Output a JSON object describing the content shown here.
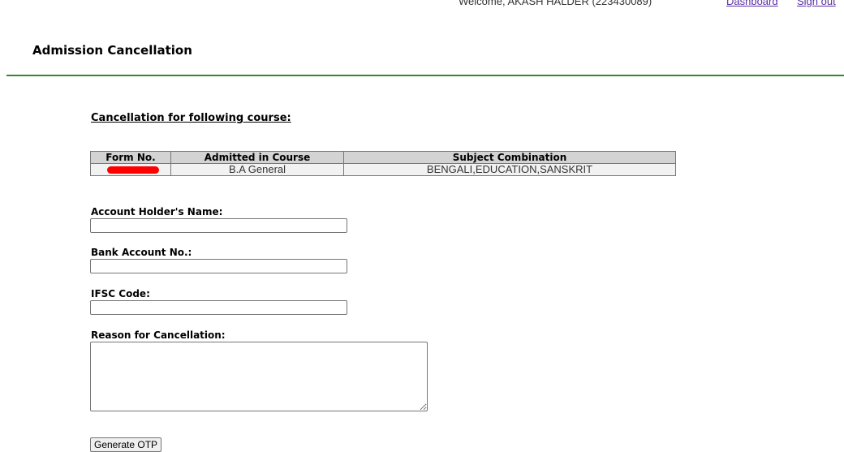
{
  "header": {
    "welcome_text": "Welcome, AKASH HALDER (223430089)",
    "dashboard_link": "Dashboard",
    "signout_link": "Sign out"
  },
  "page": {
    "title": "Admission Cancellation"
  },
  "cancellation": {
    "heading": "Cancellation for following course:",
    "table": {
      "headers": [
        "Form No.",
        "Admitted in Course",
        "Subject Combination"
      ],
      "rows": [
        {
          "form_no": "",
          "course": "B.A General",
          "subjects": "BENGALI,EDUCATION,SANSKRIT"
        }
      ]
    }
  },
  "form": {
    "account_holder_label": "Account Holder's Name:",
    "account_holder_value": "",
    "bank_account_label": "Bank Account No.:",
    "bank_account_value": "",
    "ifsc_label": "IFSC Code:",
    "ifsc_value": "",
    "reason_label": "Reason for Cancellation:",
    "reason_value": "",
    "generate_otp_label": "Generate OTP"
  },
  "colors": {
    "divider": "#2e8b2e",
    "link": "#5a2ea6",
    "table_header_bg": "#d3d3d3",
    "redaction": "#ff0000"
  }
}
